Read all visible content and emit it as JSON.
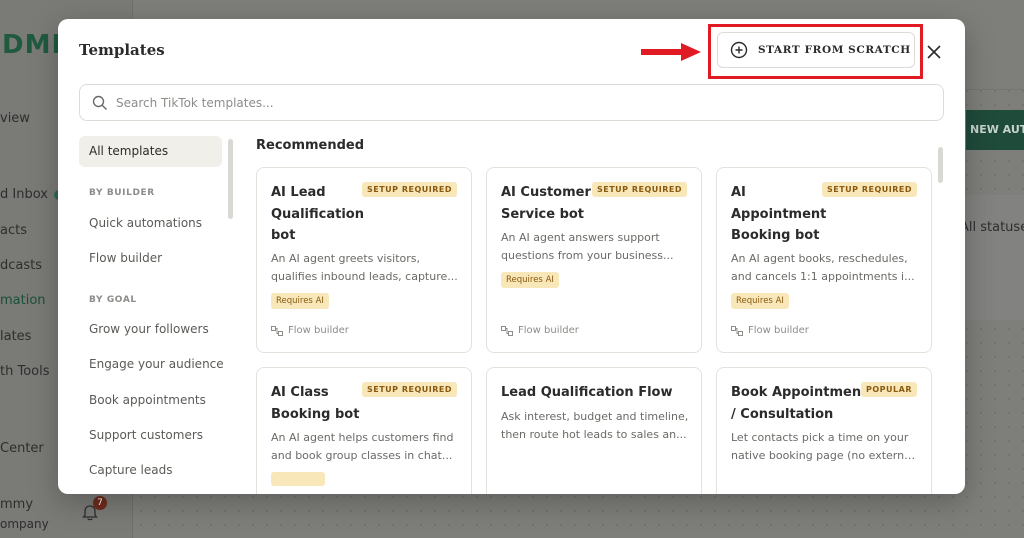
{
  "background": {
    "logo": "DMI",
    "nav": [
      "view",
      "d Inbox",
      "acts",
      "dcasts",
      "mation",
      "lates",
      "th Tools",
      "Center"
    ],
    "user_name": "mmy",
    "user_org": "ompany",
    "notification_count": "7",
    "new_button": "NEW AUTO",
    "status_filter": "All statuses"
  },
  "modal": {
    "title": "Templates",
    "start_from_scratch": "START FROM SCRATCH",
    "search_placeholder": "Search TikTok templates..."
  },
  "filters": {
    "all": "All templates",
    "by_builder_label": "BY BUILDER",
    "quick_automations": "Quick automations",
    "flow_builder": "Flow builder",
    "by_goal_label": "BY GOAL",
    "grow_followers": "Grow your followers",
    "engage_audience": "Engage your audience",
    "book_appointments": "Book appointments",
    "support_customers": "Support customers",
    "capture_leads": "Capture leads"
  },
  "section_title": "Recommended",
  "cards": [
    {
      "title_lines": [
        "AI Lead",
        "Qualification",
        "bot"
      ],
      "badge": "SETUP REQUIRED",
      "desc_lines": [
        "An AI agent greets visitors,",
        "qualifies inbound leads, capture..."
      ],
      "tag": "Requires AI",
      "footer": "Flow builder"
    },
    {
      "title_lines": [
        "AI Customer",
        "Service bot"
      ],
      "badge": "SETUP REQUIRED",
      "desc_lines": [
        "An AI agent answers support",
        "questions from your business..."
      ],
      "tag": "Requires AI",
      "footer": "Flow builder"
    },
    {
      "title_lines": [
        "AI",
        "Appointment",
        "Booking bot"
      ],
      "badge": "SETUP REQUIRED",
      "desc_lines": [
        "An AI agent books, reschedules,",
        "and cancels 1:1 appointments i..."
      ],
      "tag": "Requires AI",
      "footer": "Flow builder"
    },
    {
      "title_lines": [
        "AI Class",
        "Booking bot"
      ],
      "badge": "SETUP REQUIRED",
      "desc_lines": [
        "An AI agent helps customers find",
        "and book group classes in chat..."
      ]
    },
    {
      "title_lines": [
        "Lead Qualification Flow"
      ],
      "desc_lines": [
        "Ask interest, budget and timeline,",
        "then route hot leads to sales an..."
      ]
    },
    {
      "title_lines": [
        "Book Appointment",
        "/ Consultation"
      ],
      "badge": "POPULAR",
      "desc_lines": [
        "Let contacts pick a time on your",
        "native booking page (no externa..."
      ]
    }
  ]
}
